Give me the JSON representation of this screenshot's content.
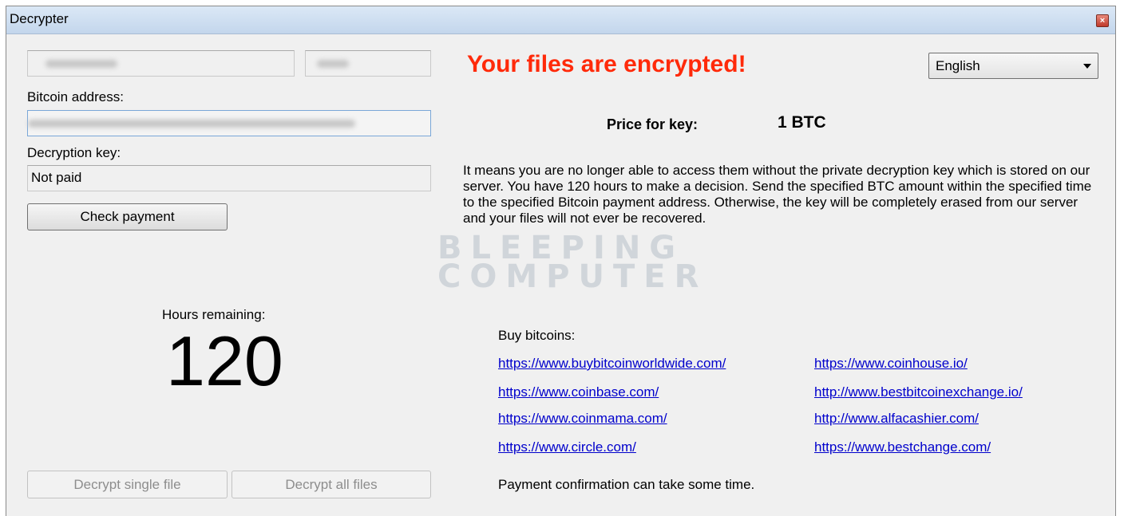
{
  "window": {
    "title": "Decrypter",
    "close_glyph": "×"
  },
  "left_panel": {
    "bitcoin_address_label": "Bitcoin address:",
    "decryption_key_label": "Decryption key:",
    "decryption_key_value": "Not paid",
    "check_payment_label": "Check payment",
    "hours_remaining_label": "Hours remaining:",
    "hours_remaining_value": "120",
    "decrypt_single_label": "Decrypt single file",
    "decrypt_all_label": "Decrypt all files"
  },
  "right_panel": {
    "headline": "Your files are encrypted!",
    "language_selected": "English",
    "price_label": "Price for key:",
    "price_value": "1 BTC",
    "description": "It means you are no longer able to access them without the private decryption key which is stored on our server. You have 120 hours to make a decision. Send the specified BTC amount within the specified time to the specified Bitcoin payment address. Otherwise, the key will be completely erased from our server and your files will not ever be recovered.",
    "buy_bitcoins_label": "Buy bitcoins:",
    "links_left": [
      "https://www.buybitcoinworldwide.com/",
      "https://www.coinbase.com/",
      "https://www.coinmama.com/",
      "https://www.circle.com/"
    ],
    "links_right": [
      "https://www.coinhouse.io/",
      "http://www.bestbitcoinexchange.io/",
      "http://www.alfacashier.com/",
      "https://www.bestchange.com/"
    ],
    "confirmation_note": "Payment confirmation can take some time."
  },
  "watermark": {
    "line1": "BLEEPING",
    "line2": "COMPUTER"
  },
  "colors": {
    "headline": "#ff2a0a",
    "link": "#0000cc"
  }
}
